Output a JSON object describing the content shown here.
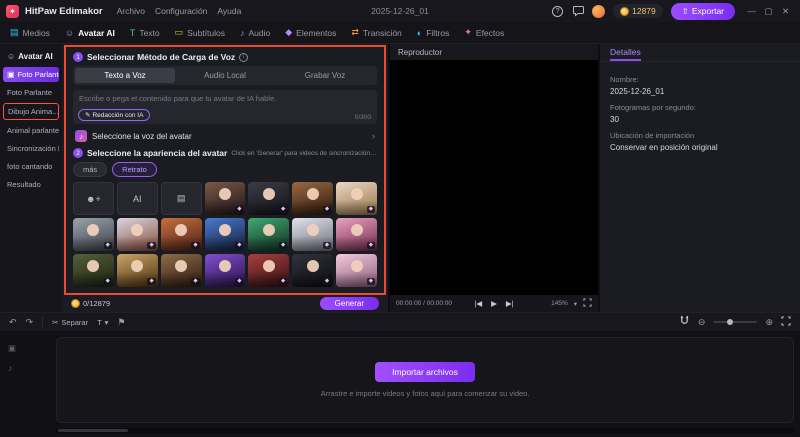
{
  "titlebar": {
    "app_name": "HitPaw Edimakor",
    "menus": [
      "Archivo",
      "Configuración",
      "Ayuda"
    ],
    "project_name": "2025-12-26_01",
    "coin_count": "12879",
    "export_label": "Exportar",
    "window_controls": [
      {
        "name": "minimize",
        "glyph": "—"
      },
      {
        "name": "maximize",
        "glyph": "▢"
      },
      {
        "name": "close",
        "glyph": "✕"
      }
    ]
  },
  "ribbon": {
    "tabs": [
      {
        "label": "Medios",
        "glyph": "▤",
        "color": "#38bdf8",
        "active": false
      },
      {
        "label": "Avatar AI",
        "glyph": "☺",
        "color": "#a78bfa",
        "active": true
      },
      {
        "label": "Texto",
        "glyph": "T",
        "color": "#34d399",
        "active": false
      },
      {
        "label": "Subtítulos",
        "glyph": "▭",
        "color": "#fbbf24",
        "active": false
      },
      {
        "label": "Audio",
        "glyph": "♪",
        "color": "#60a5fa",
        "active": false
      },
      {
        "label": "Elementos",
        "glyph": "◆",
        "color": "#c084fc",
        "active": false
      },
      {
        "label": "Transición",
        "glyph": "⇄",
        "color": "#fb923c",
        "active": false
      },
      {
        "label": "Filtros",
        "glyph": "◐",
        "color": "#22d3ee",
        "active": false
      },
      {
        "label": "Efectos",
        "glyph": "✦",
        "color": "#f472b6",
        "active": false
      }
    ]
  },
  "sidebar": {
    "items": [
      {
        "label": "Avatar AI",
        "state": "header",
        "glyph": "☺"
      },
      {
        "label": "Foto Parlante",
        "state": "active",
        "glyph": "▣"
      },
      {
        "label": "Foto Parlante",
        "state": "normal",
        "glyph": ""
      },
      {
        "label": "Dibujo Anima...",
        "state": "outlined",
        "glyph": ""
      },
      {
        "label": "Animal parlante",
        "state": "normal",
        "glyph": ""
      },
      {
        "label": "Sincronización L...",
        "state": "normal",
        "glyph": ""
      },
      {
        "label": "foto cantando",
        "state": "normal",
        "glyph": ""
      },
      {
        "label": "Resultado",
        "state": "normal",
        "glyph": ""
      }
    ]
  },
  "voice_section": {
    "step": "1",
    "title": "Seleccionar Método de Carga de Voz",
    "tabs": [
      {
        "label": "Texto a Voz",
        "active": true
      },
      {
        "label": "Audio Local",
        "active": false
      },
      {
        "label": "Grabar Voz",
        "active": false
      }
    ],
    "placeholder": "Escribe o pega el contenido para que tu avatar de IA hable.",
    "ai_button": "Redacción con IA",
    "counter": "0/300",
    "voice_picker": "Seleccione la voz del avatar"
  },
  "appearance_section": {
    "step": "2",
    "title": "Seleccione la apariencia del avatar",
    "hint": "Click en 'Generar' para videos de sincronización labial con IA.",
    "filters": [
      {
        "label": "más",
        "active": false
      },
      {
        "label": "Retrato",
        "active": true
      }
    ],
    "special_tiles": [
      {
        "name": "upload-custom-avatar-tile",
        "glyph": "☻+"
      },
      {
        "name": "ai-generate-avatar-tile",
        "glyph": "AI"
      },
      {
        "name": "preset-card-avatar-tile",
        "glyph": "▤"
      }
    ],
    "avatars": [
      {
        "c1": "#7a5a48",
        "c2": "#201318",
        "premium": true
      },
      {
        "c1": "#3c3c48",
        "c2": "#121218",
        "premium": true
      },
      {
        "c1": "#9a6a42",
        "c2": "#2e180c",
        "premium": true
      },
      {
        "c1": "#ead8c4",
        "c2": "#9a7448",
        "premium": true
      },
      {
        "c1": "#9aa2ac",
        "c2": "#3c424a",
        "premium": true
      },
      {
        "c1": "#d8d8e2",
        "c2": "#8a4a3a",
        "premium": true
      },
      {
        "c1": "#c87040",
        "c2": "#4a2014",
        "premium": true
      },
      {
        "c1": "#4a7ad0",
        "c2": "#141e3a",
        "premium": true
      },
      {
        "c1": "#42a874",
        "c2": "#103020",
        "premium": true
      },
      {
        "c1": "#e2e2ec",
        "c2": "#70707e",
        "premium": true
      },
      {
        "c1": "#eaa2c0",
        "c2": "#702a4c",
        "premium": true
      },
      {
        "c1": "#56603c",
        "c2": "#1a2010",
        "premium": true
      },
      {
        "c1": "#caa468",
        "c2": "#4c300e",
        "premium": true
      },
      {
        "c1": "#8e6c4a",
        "c2": "#2c1a0c",
        "premium": true
      },
      {
        "c1": "#8050d0",
        "c2": "#281046",
        "premium": true
      },
      {
        "c1": "#a84040",
        "c2": "#320e12",
        "premium": true
      },
      {
        "c1": "#32323c",
        "c2": "#0c0c12",
        "premium": true
      },
      {
        "c1": "#f2ccdc",
        "c2": "#8c5a7c",
        "premium": true
      }
    ]
  },
  "generate_bar": {
    "coins": "0/12879",
    "button": "Generar"
  },
  "player": {
    "title": "Reproductor",
    "time": "00:00:00 / 00:00:00",
    "zoom": "145%"
  },
  "details": {
    "tab": "Detalles",
    "fields": [
      {
        "label": "Nombre:",
        "value": "2025-12-26_01"
      },
      {
        "label": "Fotogramas por segundo:",
        "value": "30"
      },
      {
        "label": "Ubicación de importación",
        "value": "Conservar en posición original"
      }
    ]
  },
  "timeline": {
    "separar": "Separar",
    "import_button": "Importar archivos",
    "import_hint": "Arrastre e importe videos y fotos aquí para comenzar su video."
  },
  "colors": {
    "accent_purple": "#8a4df0",
    "highlight_red": "#e84a36",
    "coin_gold": "#e8b84a"
  },
  "icons": {
    "logo": "✦",
    "help": "?",
    "export": "⇧",
    "undo": "↶",
    "redo": "↷",
    "scissors": "✂",
    "text_tool": "T",
    "dropdown": "▾",
    "marker": "⚑",
    "zoom_in": "⊕",
    "zoom_out": "⊖",
    "prev": "|◀",
    "play": "▶",
    "next": "▶|",
    "chevron_right": "›",
    "music": "♪",
    "info": "i",
    "pen": "✎",
    "premium": "◆",
    "video_track": "▣",
    "audio_track": "♪"
  }
}
